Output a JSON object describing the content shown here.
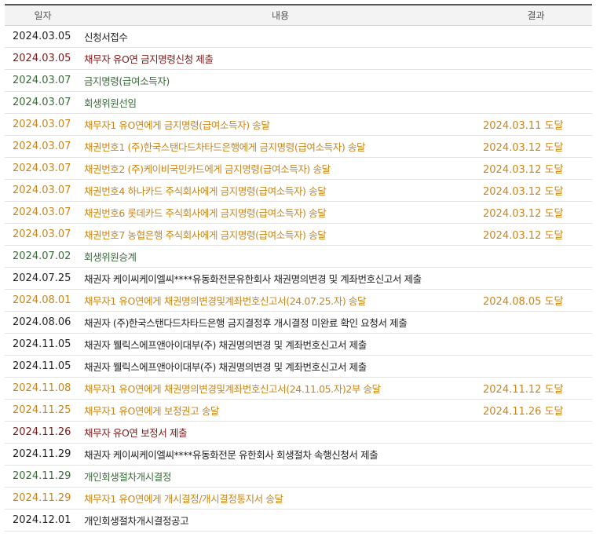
{
  "header": {
    "date": "일자",
    "content": "내용",
    "result": "결과"
  },
  "colors": {
    "black": "#222222",
    "red": "#7a1a1a",
    "green": "#3a6a3a",
    "orange": "#c8861a"
  },
  "rows": [
    {
      "date": "2024.03.05",
      "content": "신청서접수",
      "result": "",
      "category": "black"
    },
    {
      "date": "2024.03.05",
      "content": "채무자 유O연 금지명령신청 제출",
      "result": "",
      "category": "red"
    },
    {
      "date": "2024.03.07",
      "content": "금지명령(급여소득자)",
      "result": "",
      "category": "green"
    },
    {
      "date": "2024.03.07",
      "content": "회생위원선임",
      "result": "",
      "category": "green"
    },
    {
      "date": "2024.03.07",
      "content": "채무자1 유O연에게 금지명령(급여소득자) 송달",
      "result": "2024.03.11 도달",
      "category": "orange"
    },
    {
      "date": "2024.03.07",
      "content": "채권번호1 (주)한국스탠다드차타드은행에게 금지명령(급여소득자) 송달",
      "result": "2024.03.12 도달",
      "category": "orange"
    },
    {
      "date": "2024.03.07",
      "content": "채권번호2 (주)케이비국민카드에게 금지명령(급여소득자) 송달",
      "result": "2024.03.12 도달",
      "category": "orange"
    },
    {
      "date": "2024.03.07",
      "content": "채권번호4 하나카드 주식회사에게 금지명령(급여소득자) 송달",
      "result": "2024.03.12 도달",
      "category": "orange"
    },
    {
      "date": "2024.03.07",
      "content": "채권번호6 롯데카드 주식회사에게 금지명령(급여소득자) 송달",
      "result": "2024.03.12 도달",
      "category": "orange"
    },
    {
      "date": "2024.03.07",
      "content": "채권번호7 농협은행 주식회사에게 금지명령(급여소득자) 송달",
      "result": "2024.03.12 도달",
      "category": "orange"
    },
    {
      "date": "2024.07.02",
      "content": "회생위원승계",
      "result": "",
      "category": "green"
    },
    {
      "date": "2024.07.25",
      "content": "채권자 케이씨케이엘씨****유동화전문유한회사 채권명의변경 및 계좌번호신고서 제출",
      "result": "",
      "category": "black"
    },
    {
      "date": "2024.08.01",
      "content": "채무자1 유O연에게 채권명의변경및계좌번호신고서(24.07.25.자) 송달",
      "result": "2024.08.05 도달",
      "category": "orange"
    },
    {
      "date": "2024.08.06",
      "content": "채권자 (주)한국스탠다드차타드은행 금지결정후 개시결정 미완료 확인 요청서 제출",
      "result": "",
      "category": "black"
    },
    {
      "date": "2024.11.05",
      "content": "채권자 웰릭스에프앤아이대부(주) 채권명의변경 및 계좌번호신고서 제출",
      "result": "",
      "category": "black"
    },
    {
      "date": "2024.11.05",
      "content": "채권자 웰릭스에프앤아이대부(주) 채권명의변경 및 계좌번호신고서 제출",
      "result": "",
      "category": "black"
    },
    {
      "date": "2024.11.08",
      "content": "채무자1 유O연에게 채권명의변경및계좌번호신고서(24.11.05.자)2부 송달",
      "result": "2024.11.12 도달",
      "category": "orange"
    },
    {
      "date": "2024.11.25",
      "content": "채무자1 유O연에게 보정권고 송달",
      "result": "2024.11.26 도달",
      "category": "orange"
    },
    {
      "date": "2024.11.26",
      "content": "채무자 유O연 보정서 제출",
      "result": "",
      "category": "red"
    },
    {
      "date": "2024.11.29",
      "content": "채권자 케이씨케이엘씨****유동화전문 유한회사 회생절차 속행신청서 제출",
      "result": "",
      "category": "black"
    },
    {
      "date": "2024.11.29",
      "content": "개인회생절차개시결정",
      "result": "",
      "category": "green"
    },
    {
      "date": "2024.11.29",
      "content": "채무자1 유O연에게 개시결정/개시결정통지서 송달",
      "result": "",
      "category": "orange"
    },
    {
      "date": "2024.12.01",
      "content": "개인회생절차개시결정공고",
      "result": "",
      "category": "black"
    }
  ]
}
